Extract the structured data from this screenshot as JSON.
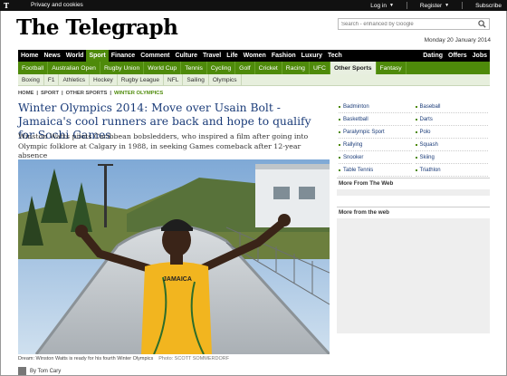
{
  "topbar": {
    "logo_mark": "T",
    "privacy": "Privacy and cookies",
    "login": "Log in",
    "register": "Register",
    "subscribe": "Subscribe"
  },
  "masthead": {
    "title": "The Telegraph"
  },
  "search": {
    "placeholder": "Search - enhanced by Google"
  },
  "date": "Monday 20 January 2014",
  "nav_main": [
    "Home",
    "News",
    "World",
    "Sport",
    "Finance",
    "Comment",
    "Culture",
    "Travel",
    "Life",
    "Women",
    "Fashion",
    "Luxury",
    "Tech"
  ],
  "nav_main_right": [
    "Dating",
    "Offers",
    "Jobs"
  ],
  "nav_sport": [
    "Football",
    "Australian Open",
    "Rugby Union",
    "World Cup",
    "Tennis",
    "Cycling",
    "Golf",
    "Cricket",
    "Racing",
    "UFC",
    "Other Sports",
    "Fantasy"
  ],
  "nav_other": [
    "Boxing",
    "F1",
    "Athletics",
    "Hockey",
    "Rugby League",
    "NFL",
    "Sailing",
    "Olympics"
  ],
  "breadcrumb": [
    "HOME",
    "SPORT",
    "OTHER SPORTS",
    "WINTER OLYMPICS"
  ],
  "article": {
    "headline": "Winter Olympics 2014: Move over Usain Bolt - Jamaica's cool runners are back and hope to qualify for Sochi Games",
    "standfirst": "Winston Watts pilots Caribbean bobsledders, who inspired a film after going into Olympic folklore at Calgary in 1988, in seeking Games comeback after 12-year absence",
    "caption": "Dream: Winston Watts is ready for his fourth Winter Olympics",
    "credit": "Photo: SCOTT SOMMERDORF",
    "shirt_text": "JAMAICA",
    "bottom_text": "By Tom Cary"
  },
  "sidebar": {
    "sports_left": [
      "Badminton",
      "Basketball",
      "Paralympic Sport",
      "Rallying",
      "Snooker",
      "Table Tennis"
    ],
    "sports_right": [
      "Baseball",
      "Darts",
      "Polo",
      "Squash",
      "Skiing",
      "Triathlon"
    ],
    "more_web_1": "More From The Web",
    "more_web_2": "More from the web"
  },
  "colors": {
    "sport_green": "#4e8a0a",
    "headline_blue": "#1a3b78",
    "topbar": "#111111"
  }
}
